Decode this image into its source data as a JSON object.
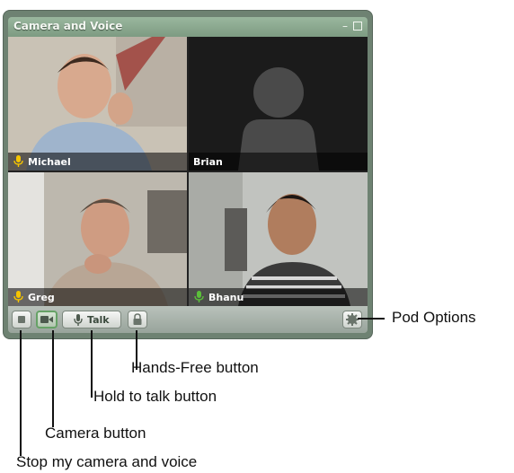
{
  "window": {
    "title": "Camera and Voice"
  },
  "participants": [
    {
      "name": "Michael",
      "mic": true,
      "camera": true
    },
    {
      "name": "Brian",
      "mic": false,
      "camera": false
    },
    {
      "name": "Greg",
      "mic": true,
      "camera": true
    },
    {
      "name": "Bhanu",
      "mic": true,
      "camera": true
    }
  ],
  "toolbar": {
    "talk_label": "Talk"
  },
  "callouts": {
    "pod_options": "Pod Options",
    "hands_free": "Hands-Free button",
    "hold_to_talk": "Hold to talk button",
    "camera": "Camera button",
    "stop": "Stop my camera and voice"
  },
  "colors": {
    "pod_frame": "#6e8272",
    "title_bar": "#8fae93",
    "mic_icon": "#f5c400",
    "camera_active": "#66a266"
  }
}
